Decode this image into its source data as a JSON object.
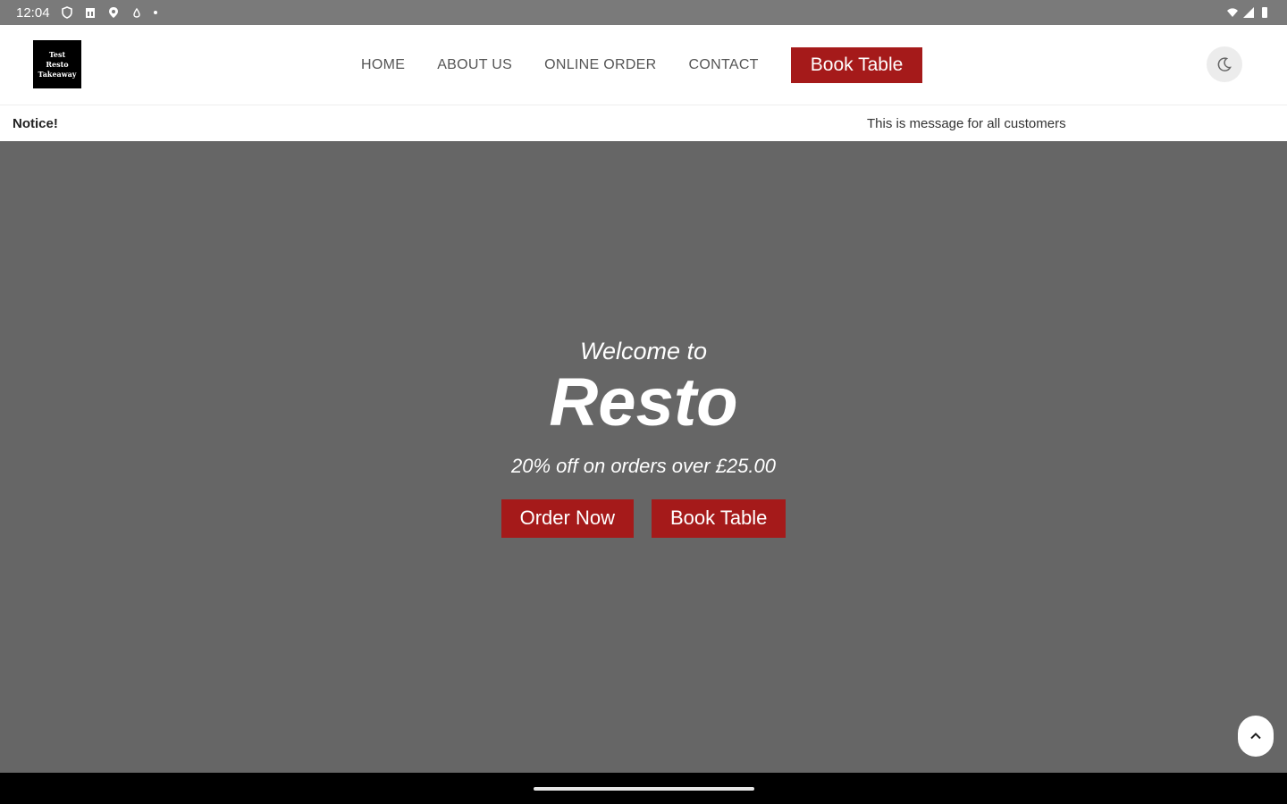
{
  "status_bar": {
    "time": "12:04",
    "left_icons": [
      "shield-icon",
      "sim-icon",
      "location-icon",
      "water-drop-icon",
      "dot-icon"
    ],
    "right_icons": [
      "wifi-icon",
      "signal-icon",
      "battery-icon"
    ]
  },
  "header": {
    "logo_lines": [
      "Test",
      "Resto",
      "Takeaway"
    ],
    "nav": [
      "HOME",
      "ABOUT US",
      "ONLINE ORDER",
      "CONTACT"
    ],
    "book_label": "Book Table",
    "theme_icon": "moon-icon"
  },
  "notice": {
    "label": "Notice!",
    "message": "This is message for all customers"
  },
  "hero": {
    "welcome": "Welcome to",
    "brand": "Resto",
    "promo": "20% off on orders over £25.00",
    "order_label": "Order Now",
    "book_label": "Book Table"
  },
  "colors": {
    "accent": "#a51a1a",
    "hero_bg": "#666666"
  }
}
